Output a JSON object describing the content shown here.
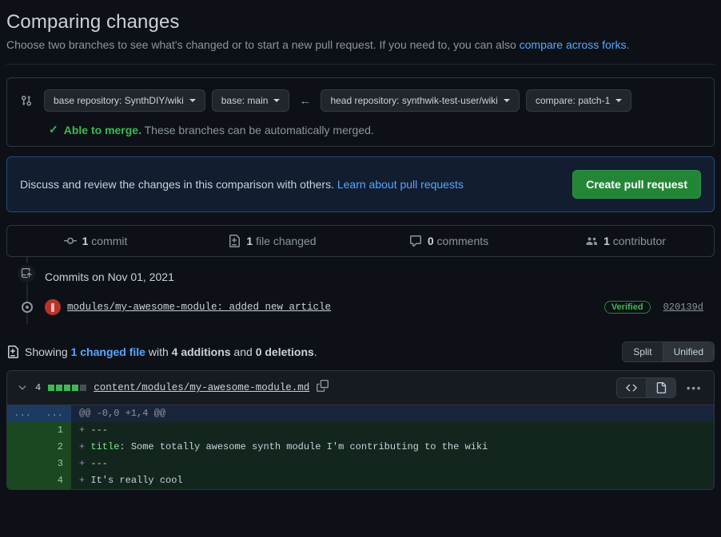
{
  "header": {
    "title": "Comparing changes",
    "subtitle_before": "Choose two branches to see what's changed or to start a new pull request. If you need to, you can also ",
    "subtitle_link": "compare across forks",
    "subtitle_after": "."
  },
  "branch_bar": {
    "compare_icon": "git-compare-icon",
    "base_repo": "base repository: SynthDIY/wiki",
    "base_branch": "base: main",
    "arrow": "←",
    "head_repo": "head repository: synthwik-test-user/wiki",
    "compare_branch": "compare: patch-1",
    "merge_check": "✓",
    "merge_status_bold": "Able to merge.",
    "merge_status_rest": " These branches can be automatically merged.",
    "merge_color": "#3fb950"
  },
  "pr_banner": {
    "text_before": "Discuss and review the changes in this comparison with others. ",
    "link": "Learn about pull requests",
    "button": "Create pull request",
    "button_color": "#238636",
    "border_color": "#1f4a7d",
    "background": "#121d2f"
  },
  "stats": [
    {
      "icon": "commit-icon",
      "value": "1",
      "label": " commit"
    },
    {
      "icon": "file-diff-icon",
      "value": "1",
      "label": " file changed"
    },
    {
      "icon": "comment-icon",
      "value": "0",
      "label": " comments"
    },
    {
      "icon": "people-icon",
      "value": "1",
      "label": " contributor"
    }
  ],
  "timeline": {
    "push_icon": "repo-push-icon",
    "date_heading": "Commits on Nov 01, 2021",
    "commit": {
      "avatar": "user-avatar",
      "message": "modules/my-awesome-module: added new article",
      "verified_badge": "Verified",
      "verified_color": "#3fb950",
      "sha": "020139d"
    }
  },
  "showing": {
    "icon": "file-diff-icon",
    "text_1": "Showing ",
    "changed_file_link": "1 changed file",
    "text_2": " with ",
    "additions": "4 additions",
    "text_3": " and ",
    "deletions": "0 deletions",
    "text_4": ".",
    "view_split": "Split",
    "view_unified": "Unified",
    "view_active": "Unified"
  },
  "diff": {
    "chevron": "chevron-down-icon",
    "change_count": "4",
    "diffstat_blocks": [
      "add",
      "add",
      "add",
      "add",
      "none"
    ],
    "filename": "content/modules/my-awesome-module.md",
    "copy_icon": "copy-icon",
    "code_view_icon": "code-icon",
    "file_view_icon": "file-icon",
    "kebab_icon": "kebab-menu-icon",
    "rows": [
      {
        "type": "hunk",
        "old": "...",
        "new": "...",
        "marker": "",
        "text": "@@ -0,0 +1,4 @@"
      },
      {
        "type": "add",
        "old": "",
        "new": "1",
        "marker": "+ ",
        "text": "---"
      },
      {
        "type": "add",
        "old": "",
        "new": "2",
        "marker": "+ ",
        "key": "title",
        "text": ": Some totally awesome synth module I'm contributing to the wiki"
      },
      {
        "type": "add",
        "old": "",
        "new": "3",
        "marker": "+ ",
        "text": "---"
      },
      {
        "type": "add",
        "old": "",
        "new": "4",
        "marker": "+ ",
        "text": "It's really cool"
      }
    ]
  }
}
